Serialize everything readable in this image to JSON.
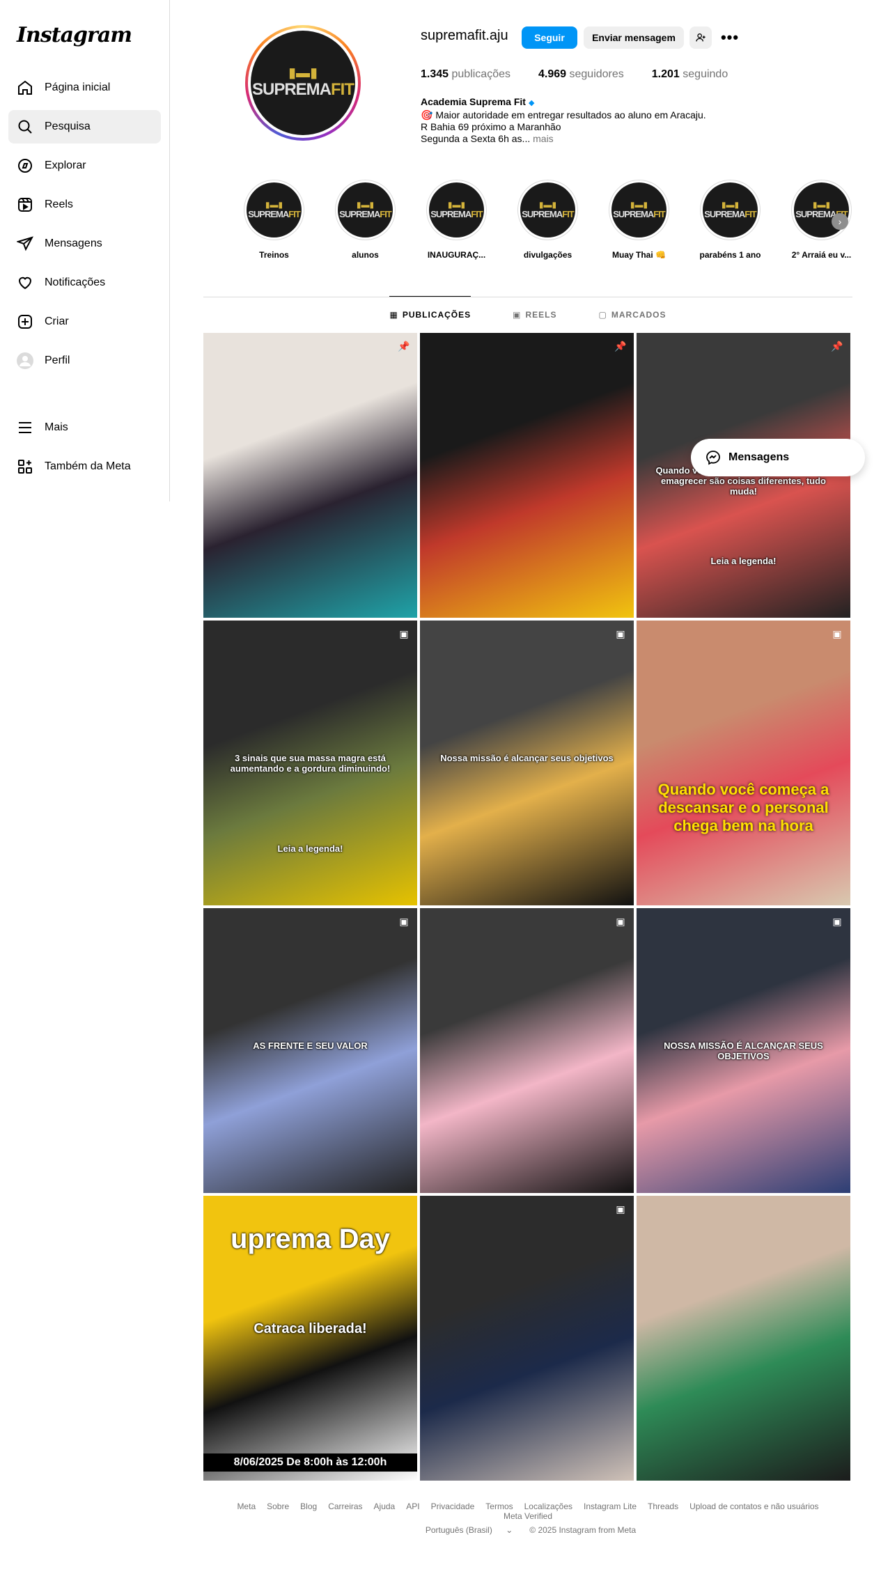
{
  "app": {
    "logo": "Instagram"
  },
  "sidebar": {
    "items": [
      {
        "label": "Página inicial",
        "icon": "home-icon"
      },
      {
        "label": "Pesquisa",
        "icon": "search-icon"
      },
      {
        "label": "Explorar",
        "icon": "compass-icon"
      },
      {
        "label": "Reels",
        "icon": "reels-icon"
      },
      {
        "label": "Mensagens",
        "icon": "send-icon"
      },
      {
        "label": "Notificações",
        "icon": "heart-icon"
      },
      {
        "label": "Criar",
        "icon": "plus-square-icon"
      },
      {
        "label": "Perfil",
        "icon": "avatar-icon"
      }
    ],
    "bottom_items": [
      {
        "label": "Mais",
        "icon": "menu-icon"
      },
      {
        "label": "Também da Meta",
        "icon": "meta-icon"
      }
    ],
    "active_index": 1
  },
  "profile": {
    "username": "supremafit.aju",
    "follow_label": "Seguir",
    "message_label": "Enviar mensagem",
    "stats": {
      "posts_count": "1.345",
      "posts_label": "publicações",
      "followers_count": "4.969",
      "followers_label": "seguidores",
      "following_count": "1.201",
      "following_label": "seguindo"
    },
    "bio": {
      "name": "Academia Suprema Fit",
      "line1": "🎯 Maior autoridade em entregar resultados ao aluno em Aracaju.",
      "line2": "R Bahia 69 próximo a Maranhão",
      "line3": "Segunda a Sexta 6h as...",
      "more": "mais"
    },
    "logo_text": {
      "brand": "SUPREMA",
      "brand2": "FIT",
      "mark": "▮▬▮"
    }
  },
  "highlights": [
    {
      "label": "Treinos"
    },
    {
      "label": "alunos"
    },
    {
      "label": "INAUGURAÇ..."
    },
    {
      "label": "divulgações"
    },
    {
      "label": "Muay Thai 👊"
    },
    {
      "label": "parabéns 1 ano"
    },
    {
      "label": "2° Arraiá eu v..."
    }
  ],
  "tabs": [
    {
      "label": "PUBLICAÇÕES",
      "icon": "grid-icon",
      "active": true
    },
    {
      "label": "REELS",
      "icon": "reels-icon",
      "active": false
    },
    {
      "label": "MARCADOS",
      "icon": "tagged-icon",
      "active": false
    }
  ],
  "posts": [
    {
      "badge": "pin-icon",
      "caption": "",
      "colors": [
        "#e8e2dc",
        "#2a2230",
        "#1fa3a8"
      ]
    },
    {
      "badge": "pin-icon",
      "caption": "",
      "colors": [
        "#1a1a1a",
        "#c0392b",
        "#f1c40f"
      ]
    },
    {
      "badge": "pin-icon",
      "caption": "Quando você aprende que perder peso e emagrecer são coisas diferentes, tudo muda!",
      "caption2": "Leia a legenda!",
      "colors": [
        "#3a3a3a",
        "#d9534f",
        "#222"
      ]
    },
    {
      "badge": "reel-icon",
      "caption": "3 sinais que sua massa magra está aumentando e a gordura diminuindo!",
      "caption2": "Leia a legenda!",
      "colors": [
        "#2b2b2b",
        "#6b7a3e",
        "#e6c200"
      ]
    },
    {
      "badge": "reel-icon",
      "caption": "Nossa missão é alcançar seus objetivos",
      "caption2": "",
      "colors": [
        "#444",
        "#e3b04b",
        "#111"
      ]
    },
    {
      "badge": "reel-icon",
      "caption": "Quando você começa a descansar e o personal chega bem na hora",
      "caption2": "",
      "colors": [
        "#c98b6e",
        "#e44a5a",
        "#d8c9b0"
      ]
    },
    {
      "badge": "reel-icon",
      "caption": "AS FRENTE E SEU VALOR",
      "caption2": "",
      "colors": [
        "#333",
        "#8fa0d8",
        "#222"
      ]
    },
    {
      "badge": "reel-icon",
      "caption": "",
      "caption2": "",
      "colors": [
        "#3a3a3a",
        "#f3b6c7",
        "#111"
      ]
    },
    {
      "badge": "reel-icon",
      "caption": "NOSSA MISSÃO É ALCANÇAR SEUS OBJETIVOS",
      "caption2": "",
      "colors": [
        "#2e3440",
        "#e79aa8",
        "#2c3e74"
      ]
    },
    {
      "badge": "none",
      "caption": "uprema Day",
      "caption2": "Catraca liberada!",
      "caption3": "8/06/2025   De 8:00h às 12:00h",
      "colors": [
        "#f1c40f",
        "#111",
        "#fff"
      ]
    },
    {
      "badge": "reel-icon",
      "caption": "",
      "caption2": "",
      "colors": [
        "#2c2c2c",
        "#1c2a4a",
        "#d0c2b8"
      ]
    },
    {
      "badge": "none",
      "caption": "",
      "caption2": "",
      "colors": [
        "#cfb8a5",
        "#2e8b57",
        "#1c1c1c"
      ]
    }
  ],
  "floating_messages": {
    "label": "Mensagens"
  },
  "footer": {
    "links": [
      "Meta",
      "Sobre",
      "Blog",
      "Carreiras",
      "Ajuda",
      "API",
      "Privacidade",
      "Termos",
      "Localizações",
      "Instagram Lite",
      "Threads",
      "Upload de contatos e não usuários",
      "Meta Verified"
    ],
    "language": "Português (Brasil)",
    "copyright": "© 2025 Instagram from Meta"
  }
}
